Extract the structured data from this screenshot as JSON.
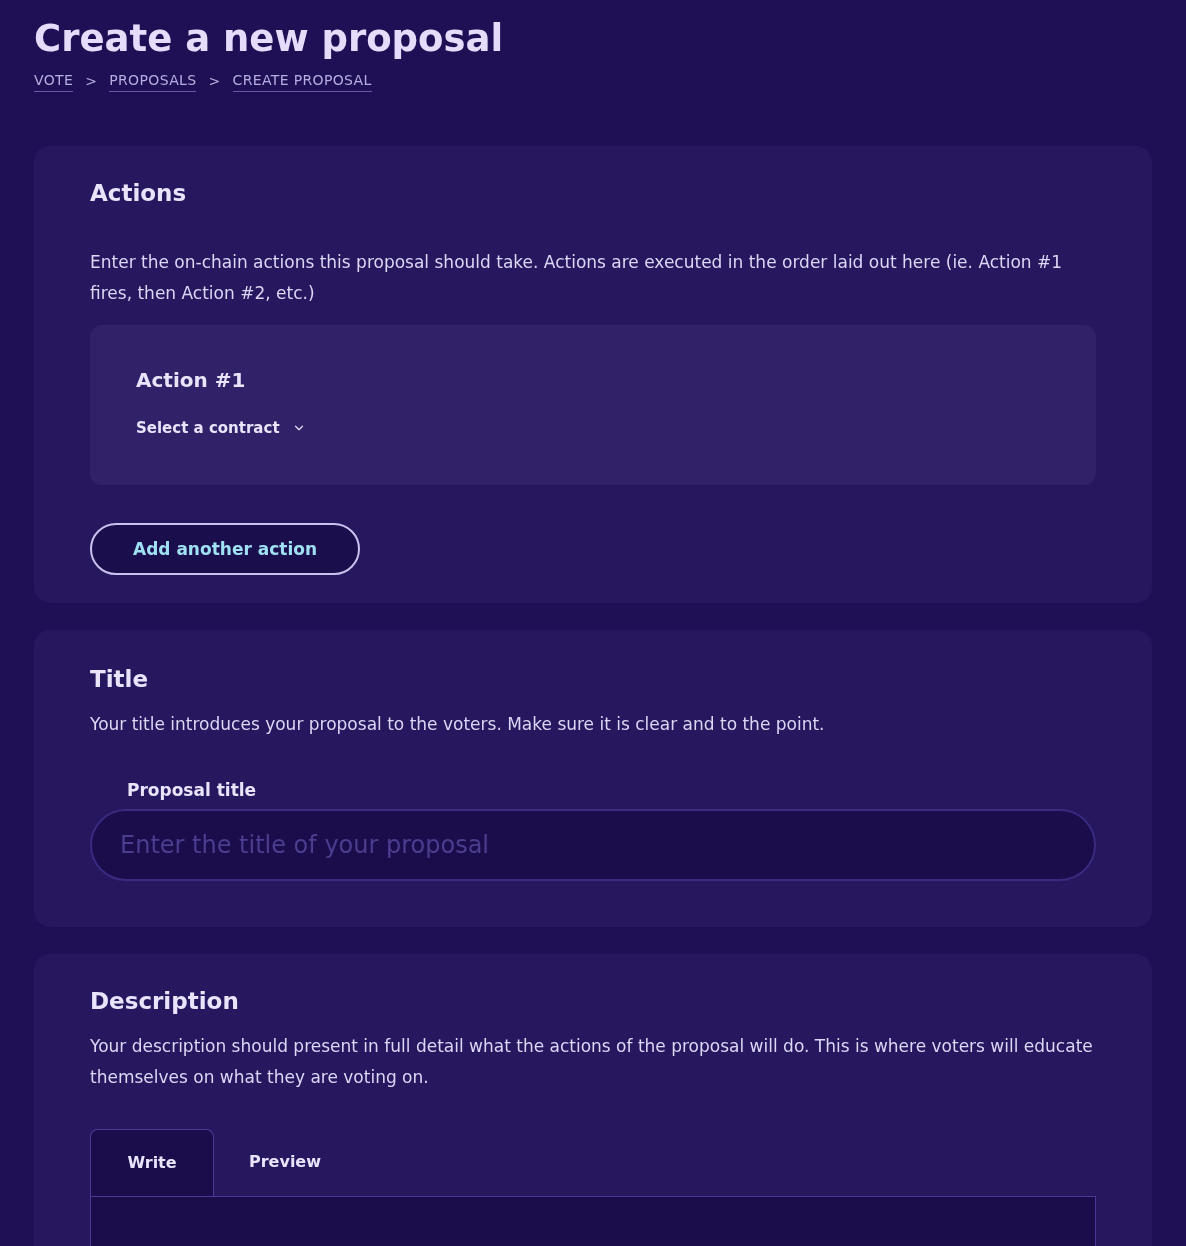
{
  "page": {
    "title": "Create a new proposal"
  },
  "breadcrumbs": [
    {
      "label": "VOTE"
    },
    {
      "label": "PROPOSALS"
    },
    {
      "label": "CREATE PROPOSAL"
    }
  ],
  "breadcrumb_separator": ">",
  "actions_section": {
    "heading": "Actions",
    "description": "Enter the on-chain actions this proposal should take. Actions are executed in the order laid out here (ie. Action #1 fires, then Action #2, etc.)",
    "actions": [
      {
        "title": "Action #1",
        "contract_select": "Select a contract"
      }
    ],
    "add_button": "Add another action"
  },
  "title_section": {
    "heading": "Title",
    "description": "Your title introduces your proposal to the voters. Make sure it is clear and to the point.",
    "field_label": "Proposal title",
    "placeholder": "Enter the title of your proposal"
  },
  "description_section": {
    "heading": "Description",
    "description": "Your description should present in full detail what the actions of the proposal will do. This is where voters will educate themselves on what they are voting on.",
    "tabs": [
      {
        "label": "Write",
        "selected": true
      },
      {
        "label": "Preview",
        "selected": false
      }
    ]
  }
}
